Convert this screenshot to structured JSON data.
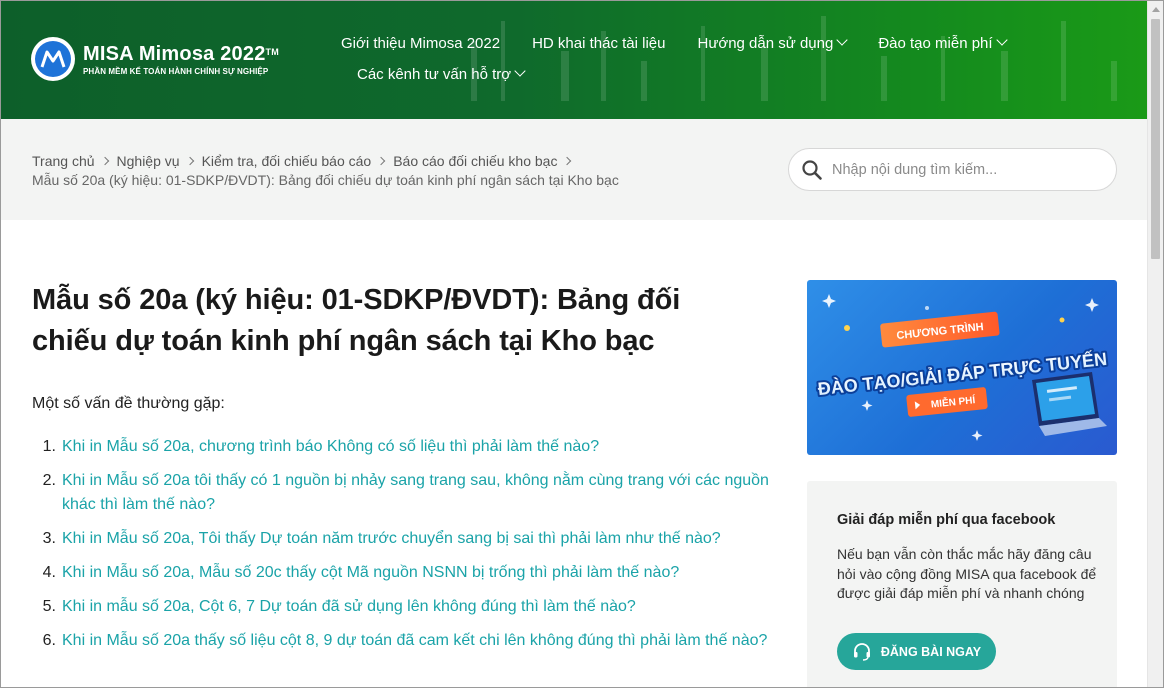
{
  "header": {
    "logo_title": "MISA Mimosa 2022",
    "logo_tm": "TM",
    "logo_subtitle": "PHẦN MỀM KẾ TOÁN HÀNH CHÍNH SỰ NGHIỆP",
    "nav": [
      {
        "label": "Giới thiệu Mimosa 2022",
        "dropdown": false
      },
      {
        "label": "HD khai thác tài liệu",
        "dropdown": false
      },
      {
        "label": "Hướng dẫn sử dụng",
        "dropdown": true
      },
      {
        "label": "Đào tạo miễn phí",
        "dropdown": true
      },
      {
        "label": "Các kênh tư vấn hỗ trợ",
        "dropdown": true
      }
    ],
    "brand_colors": {
      "dark": "#0d5f2a",
      "light": "#1a9a17"
    }
  },
  "breadcrumb": {
    "items": [
      "Trang chủ",
      "Nghiệp vụ",
      "Kiểm tra, đối chiếu báo cáo",
      "Báo cáo đối chiếu kho bạc"
    ],
    "current": "Mẫu số 20a (ký hiệu: 01-SDKP/ĐVDT): Bảng đối chiếu dự toán kinh phí ngân sách tại Kho bạc"
  },
  "search": {
    "placeholder": "Nhập nội dung tìm kiếm...",
    "icon": "search-icon"
  },
  "main": {
    "title_line1": "Mẫu số 20a (ký hiệu: 01-SDKP/ĐVDT): Bảng đối",
    "title_line2": "chiếu dự toán kinh phí ngân sách tại Kho bạc",
    "intro": "Một số vấn đề thường gặp:",
    "link_color": "#1aa3a8",
    "questions": [
      {
        "num": "1.",
        "text": "Khi in Mẫu số 20a, chương trình báo Không có số liệu thì phải làm thế nào?"
      },
      {
        "num": "2.",
        "text": "Khi in Mẫu số 20a tôi thấy có 1 nguồn bị nhảy sang trang sau, không nằm cùng trang với các nguồn khác thì làm thế nào?"
      },
      {
        "num": "3.",
        "text": "Khi in Mẫu số 20a, Tôi thấy Dự toán năm trước chuyển sang bị sai thì phải làm như thế nào?"
      },
      {
        "num": "4.",
        "text": "Khi in Mẫu số 20a, Mẫu số 20c thấy cột Mã nguồn NSNN bị trống thì phải làm thế nào?"
      },
      {
        "num": "5.",
        "text": "Khi in mẫu số 20a, Cột 6, 7 Dự toán đã sử dụng lên không đúng thì làm thế nào?"
      },
      {
        "num": "6.",
        "text": "Khi in Mẫu số 20a thấy số liệu cột 8, 9 dự toán đã cam kết chi lên không đúng thì phải làm thế nào?"
      }
    ]
  },
  "sidebar": {
    "banner": {
      "tag": "CHƯƠNG TRÌNH",
      "headline": "ĐÀO TẠO/GIẢI ĐÁP TRỰC TUYẾN",
      "badge": "MIỄN PHÍ"
    },
    "facebook_box": {
      "title": "Giải đáp miễn phí qua facebook",
      "text": "Nếu bạn vẫn còn thắc mắc hãy đăng câu hỏi vào cộng đồng MISA qua facebook để được giải đáp miễn phí và nhanh chóng",
      "button": "ĐĂNG BÀI NGAY",
      "button_color": "#26a69a"
    }
  }
}
